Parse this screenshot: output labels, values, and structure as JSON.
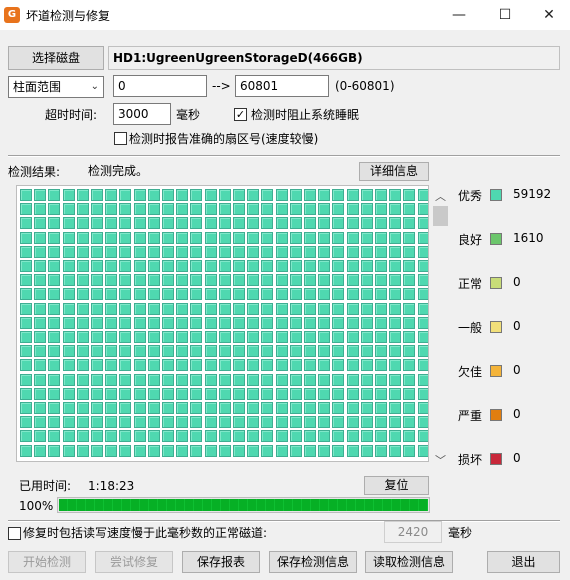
{
  "window": {
    "title": "坏道检测与修复",
    "app_icon_letter": "G",
    "minimize_glyph": "—",
    "maximize_glyph": "☐",
    "close_glyph": "✕"
  },
  "disk": {
    "select_button": "选择磁盘",
    "selected_disk": "HD1:UgreenUgreenStorageD(466GB)"
  },
  "range": {
    "mode": "柱面范围",
    "start": "0",
    "arrow": "-->",
    "end": "60801",
    "hint": "(0-60801)"
  },
  "options": {
    "timeout_label": "超时时间:",
    "timeout_value": "3000",
    "timeout_unit": "毫秒",
    "prevent_sleep_label": "检测时阻止系统睡眠",
    "prevent_sleep_checked": "✓",
    "report_sector_label": "检测时报告准确的扇区号(速度较慢)",
    "report_sector_checked": ""
  },
  "result": {
    "label": "检测结果:",
    "status": "检测完成。",
    "details_button": "详细信息"
  },
  "legend": [
    {
      "label": "优秀",
      "count": "59192",
      "color": "#4fd8b0"
    },
    {
      "label": "良好",
      "count": "1610",
      "color": "#6cc66c"
    },
    {
      "label": "正常",
      "count": "0",
      "color": "#c8dc78"
    },
    {
      "label": "一般",
      "count": "0",
      "color": "#f2e07a"
    },
    {
      "label": "欠佳",
      "count": "0",
      "color": "#f4b43a"
    },
    {
      "label": "严重",
      "count": "0",
      "color": "#e07e10"
    },
    {
      "label": "损坏",
      "count": "0",
      "color": "#c8283a"
    }
  ],
  "elapsed": {
    "label": "已用时间:",
    "value": "1:18:23",
    "reset_button": "复位"
  },
  "progress": {
    "percent_text": "100%",
    "fraction": 1.0
  },
  "repair_option": {
    "label": "修复时包括读写速度慢于此毫秒数的正常磁道:",
    "value": "2420",
    "unit": "毫秒",
    "checked": ""
  },
  "buttons": {
    "start": "开始检测",
    "try_repair": "尝试修复",
    "save_report": "保存报表",
    "save_check": "保存检测信息",
    "load_check": "读取检测信息",
    "exit": "退出"
  },
  "scrollbar": {
    "up_glyph": "︿",
    "down_glyph": "﹀"
  },
  "grid": {
    "block_status": "优秀"
  }
}
